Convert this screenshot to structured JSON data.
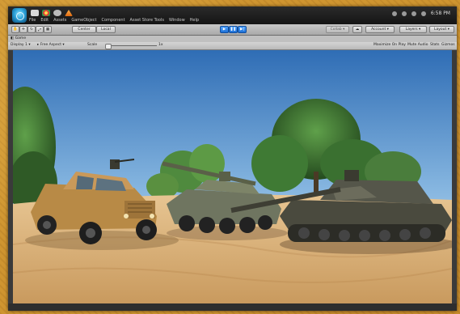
{
  "menubar": {
    "items": [
      "File",
      "Edit",
      "Assets",
      "GameObject",
      "Component",
      "Asset Store Tools",
      "Window",
      "Help"
    ],
    "clock": "6:58 PM"
  },
  "toolbar": {
    "pivot_label": "Center",
    "space_label": "Local",
    "collab_label": "Collab ▾",
    "account_label": "Account ▾",
    "layers_label": "Layers ▾",
    "layout_label": "Layout ▾"
  },
  "game_view": {
    "tab_label": "Game",
    "display_label": "Display 1",
    "aspect_label": "Free Aspect",
    "scale_label": "Scale",
    "scale_value": "1x",
    "maximize_label": "Maximize On Play",
    "mute_label": "Mute Audio",
    "stats_label": "Stats",
    "gizmos_label": "Gizmos"
  },
  "colors": {
    "sky_top": "#3f7fc4",
    "sky_bottom": "#c9ddef",
    "sand": "#d8b07a",
    "humvee": "#b88a46",
    "apc": "#6f7560",
    "tank": "#4a4a3e",
    "play_accent": "#2b86e6"
  }
}
